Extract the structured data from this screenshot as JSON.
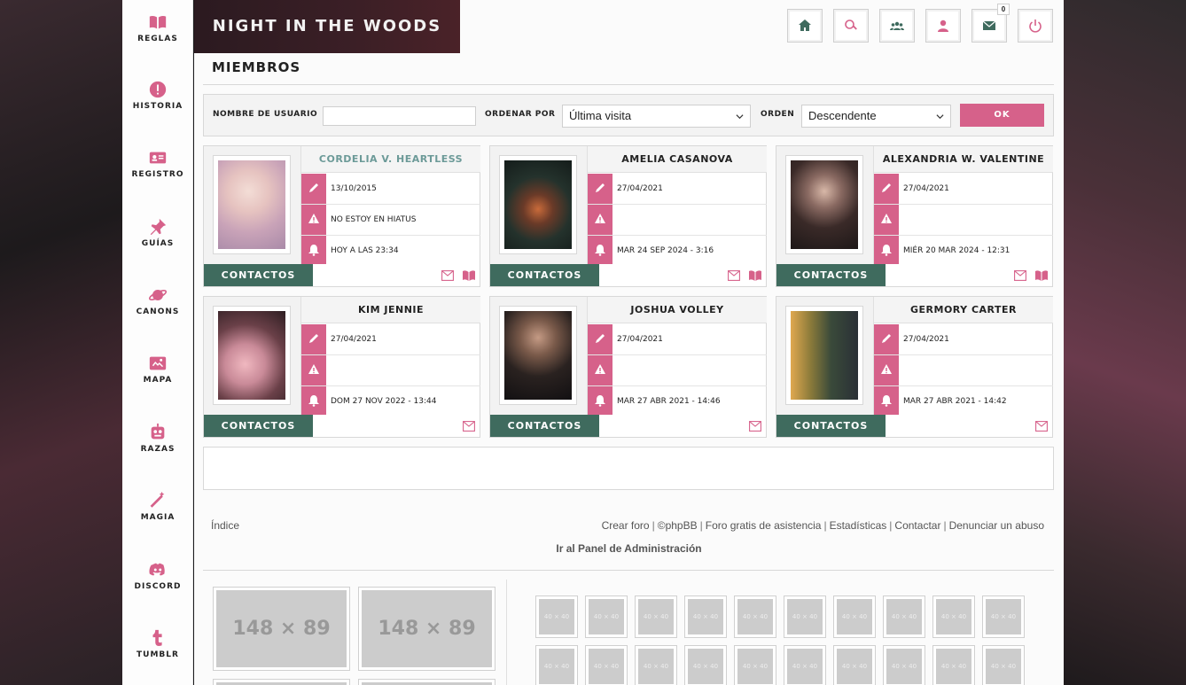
{
  "sidebar": {
    "items": [
      {
        "label": "REGLAS"
      },
      {
        "label": "HISTORIA"
      },
      {
        "label": "REGISTRO"
      },
      {
        "label": "GUÍAS"
      },
      {
        "label": "CANONS"
      },
      {
        "label": "MAPA"
      },
      {
        "label": "RAZAS"
      },
      {
        "label": "MAGIA"
      },
      {
        "label": "DISCORD"
      },
      {
        "label": "TUMBLR"
      }
    ]
  },
  "header": {
    "brand": "NIGHT IN THE WOODS",
    "messages_count": "0"
  },
  "page": {
    "title": "MIEMBROS"
  },
  "filter": {
    "username_label": "NOMBRE DE USUARIO",
    "username_value": "",
    "order_by_label": "ORDENAR POR",
    "order_by_value": "Última visita",
    "order_label": "ORDEN",
    "order_value": "Descendente",
    "ok_label": "OK"
  },
  "members": [
    {
      "name": "CORDELIA V. HEARTLESS",
      "registered": "13/10/2015",
      "status": "NO ESTOY EN HIATUS",
      "last_visit": "HOY A LAS 23:34",
      "contact_label": "CONTACTOS"
    },
    {
      "name": "AMELIA CASANOVA",
      "registered": "27/04/2021",
      "status": "",
      "last_visit": "MAR 24 SEP 2024 - 3:16",
      "contact_label": "CONTACTOS"
    },
    {
      "name": "ALEXANDRIA W. VALENTINE",
      "registered": "27/04/2021",
      "status": "",
      "last_visit": "MIÉR 20 MAR 2024 - 12:31",
      "contact_label": "CONTACTOS"
    },
    {
      "name": "KIM JENNIE",
      "registered": "27/04/2021",
      "status": "",
      "last_visit": "DOM 27 NOV 2022 - 13:44",
      "contact_label": "CONTACTOS"
    },
    {
      "name": "JOSHUA VOLLEY",
      "registered": "27/04/2021",
      "status": "",
      "last_visit": "MAR 27 ABR 2021 - 14:46",
      "contact_label": "CONTACTOS"
    },
    {
      "name": "GERMORY CARTER",
      "registered": "27/04/2021",
      "status": "",
      "last_visit": "MAR 27 ABR 2021 - 14:42",
      "contact_label": "CONTACTOS"
    }
  ],
  "footer": {
    "index_link": "Índice",
    "links": [
      "Crear foro",
      "©phpBB",
      "Foro gratis de asistencia",
      "Estadísticas",
      "Contactar",
      "Denunciar un abuso"
    ],
    "separator": "|",
    "admin_link": "Ir al Panel de Administración"
  },
  "affiliates": {
    "big_placeholder": "148 × 89",
    "small_placeholder": "40 × 40"
  },
  "colors": {
    "accent_pink": "#d6618a",
    "accent_green": "#3f6b5e",
    "name_teal": "#6c9a98",
    "brand_bg": "#3b1f26"
  }
}
